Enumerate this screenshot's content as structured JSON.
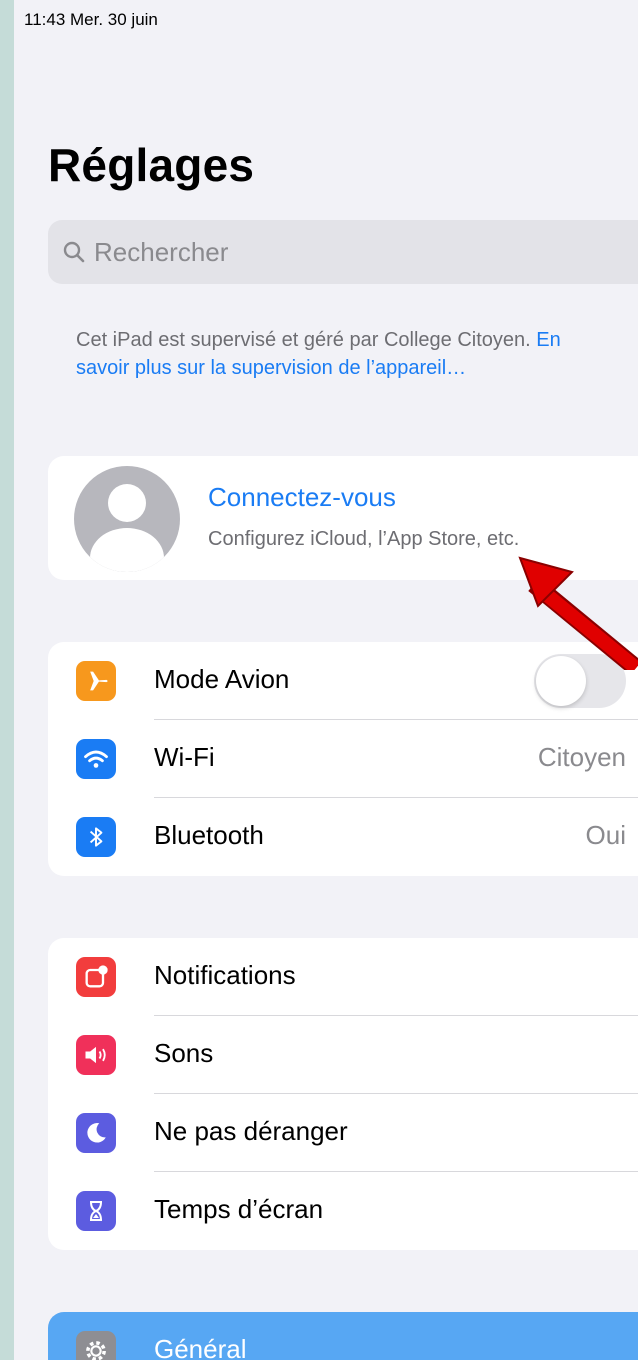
{
  "status_bar": {
    "time_date": "11:43   Mer. 30 juin"
  },
  "header": {
    "title": "Réglages"
  },
  "search": {
    "placeholder": "Rechercher",
    "icon": "search-icon"
  },
  "supervision": {
    "text": "Cet iPad est supervisé et géré par College Citoyen. ",
    "link": "En savoir plus sur la supervision de l’appareil…"
  },
  "account": {
    "title": "Connectez-vous",
    "subtitle": "Configurez iCloud, l’App Store, etc.",
    "icon": "avatar-icon"
  },
  "connectivity": [
    {
      "label": "Mode Avion",
      "toggle": false,
      "icon": "airplane-icon",
      "color": "#f7981d"
    },
    {
      "label": "Wi-Fi",
      "value": "Citoyen",
      "icon": "wifi-icon",
      "color": "#1a7cf4"
    },
    {
      "label": "Bluetooth",
      "value": "Oui",
      "icon": "bluetooth-icon",
      "color": "#1a7cf4"
    }
  ],
  "notifications_group": [
    {
      "label": "Notifications",
      "icon": "notifications-icon",
      "color": "#f23d3d"
    },
    {
      "label": "Sons",
      "icon": "speaker-icon",
      "color": "#f0305a"
    },
    {
      "label": "Ne pas déranger",
      "icon": "moon-icon",
      "color": "#5c5ce0"
    },
    {
      "label": "Temps d’écran",
      "icon": "hourglass-icon",
      "color": "#5c5ce0"
    }
  ],
  "general_group": [
    {
      "label": "Général",
      "icon": "gear-icon",
      "selected": true
    }
  ],
  "annotation": {
    "type": "red-arrow",
    "color": "#e00000"
  }
}
